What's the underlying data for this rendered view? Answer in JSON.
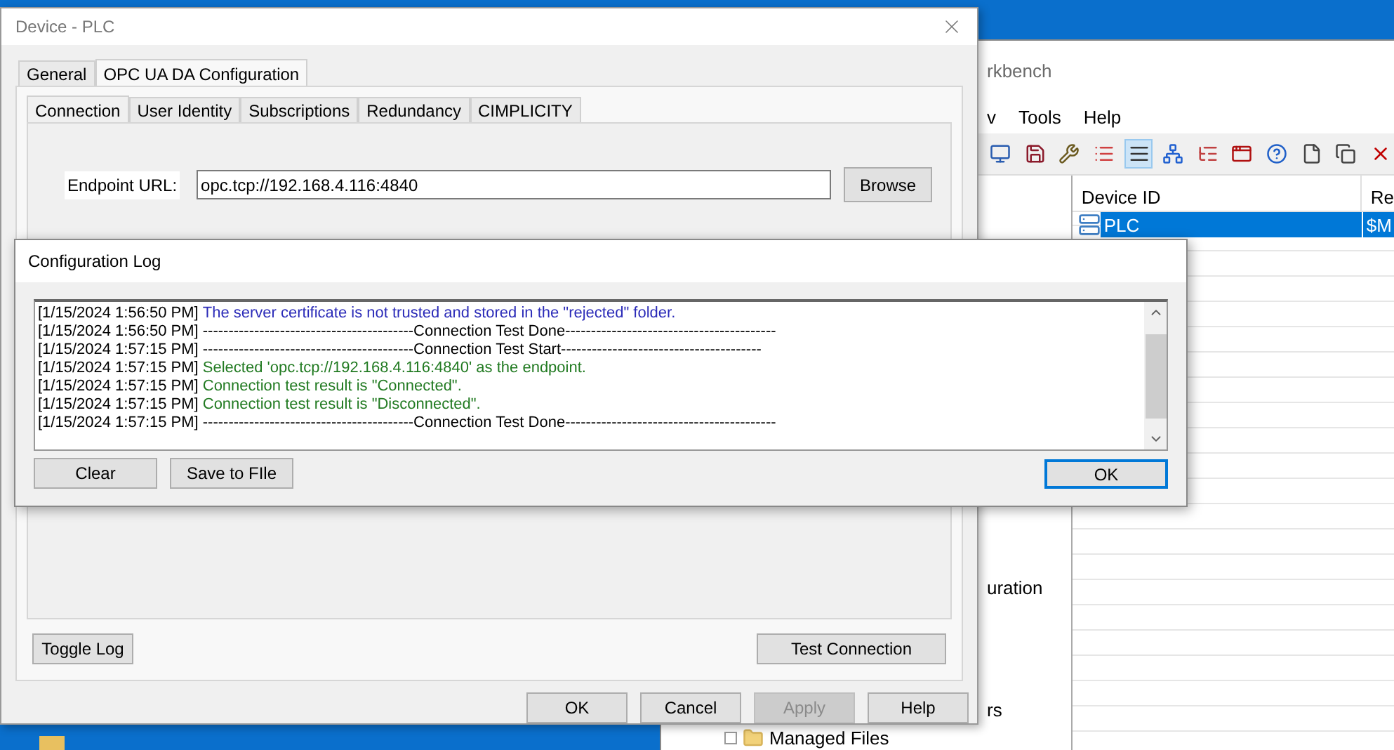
{
  "background_window": {
    "title": "rkbench",
    "menu": [
      "v",
      "Tools",
      "Help"
    ],
    "toolbar": [
      {
        "kind": "monitor",
        "selected": false
      },
      {
        "kind": "save",
        "selected": false
      },
      {
        "kind": "tools",
        "selected": false
      },
      {
        "kind": "list",
        "selected": false
      },
      {
        "kind": "details",
        "selected": true
      },
      {
        "kind": "network",
        "selected": false
      },
      {
        "kind": "tree",
        "selected": false
      },
      {
        "kind": "window",
        "selected": false
      },
      {
        "kind": "help",
        "selected": false
      },
      {
        "kind": "new",
        "selected": false
      },
      {
        "kind": "copy",
        "selected": false
      },
      {
        "kind": "delete",
        "selected": false
      }
    ],
    "tree": [
      {
        "label": "uration",
        "folder": false
      },
      {
        "label": "rs",
        "folder": false
      },
      {
        "label": "Managed Files",
        "folder": true
      }
    ],
    "grid": {
      "columns": [
        "Device ID",
        "Re"
      ],
      "rows": [
        {
          "cells": [
            "PLC",
            "$M"
          ],
          "selected": true
        }
      ]
    }
  },
  "dialog": {
    "title": "Device - PLC",
    "tabs": [
      {
        "label": "General",
        "selected": false
      },
      {
        "label": "OPC UA DA Configuration",
        "selected": true
      }
    ],
    "subtabs": [
      {
        "label": "Connection",
        "selected": true
      },
      {
        "label": "User Identity",
        "selected": false
      },
      {
        "label": "Subscriptions",
        "selected": false
      },
      {
        "label": "Redundancy",
        "selected": false
      },
      {
        "label": "CIMPLICITY",
        "selected": false
      }
    ],
    "endpoint": {
      "label": "Endpoint URL:",
      "value": "opc.tcp://192.168.4.116:4840"
    },
    "browse": "Browse",
    "toggle_log": "Toggle Log",
    "test_connection": "Test Connection",
    "buttons": [
      {
        "label": "OK",
        "disabled": false
      },
      {
        "label": "Cancel",
        "disabled": false
      },
      {
        "label": "Apply",
        "disabled": true
      },
      {
        "label": "Help",
        "disabled": false
      }
    ]
  },
  "log_dialog": {
    "title": "Configuration Log",
    "lines": [
      {
        "time": "[1/15/2024 1:56:50 PM]",
        "text": "The server certificate is not trusted and stored in the \"rejected\" folder.",
        "color": "#2b2bb8"
      },
      {
        "time": "[1/15/2024 1:56:50 PM]",
        "text": "-----------------------------------------Connection Test Done-----------------------------------------",
        "color": "#000000"
      },
      {
        "time": "[1/15/2024 1:57:15 PM]",
        "text": "-----------------------------------------Connection Test Start---------------------------------------",
        "color": "#000000"
      },
      {
        "time": "[1/15/2024 1:57:15 PM]",
        "text": "Selected 'opc.tcp://192.168.4.116:4840' as the endpoint.",
        "color": "#217a21"
      },
      {
        "time": "[1/15/2024 1:57:15 PM]",
        "text": "Connection test result is \"Connected\".",
        "color": "#217a21"
      },
      {
        "time": "[1/15/2024 1:57:15 PM]",
        "text": "Connection test result is \"Disconnected\".",
        "color": "#217a21"
      },
      {
        "time": "[1/15/2024 1:57:15 PM]",
        "text": "-----------------------------------------Connection Test Done-----------------------------------------",
        "color": "#000000"
      }
    ],
    "buttons": [
      "Clear",
      "Save to FIle"
    ],
    "ok": "OK"
  }
}
